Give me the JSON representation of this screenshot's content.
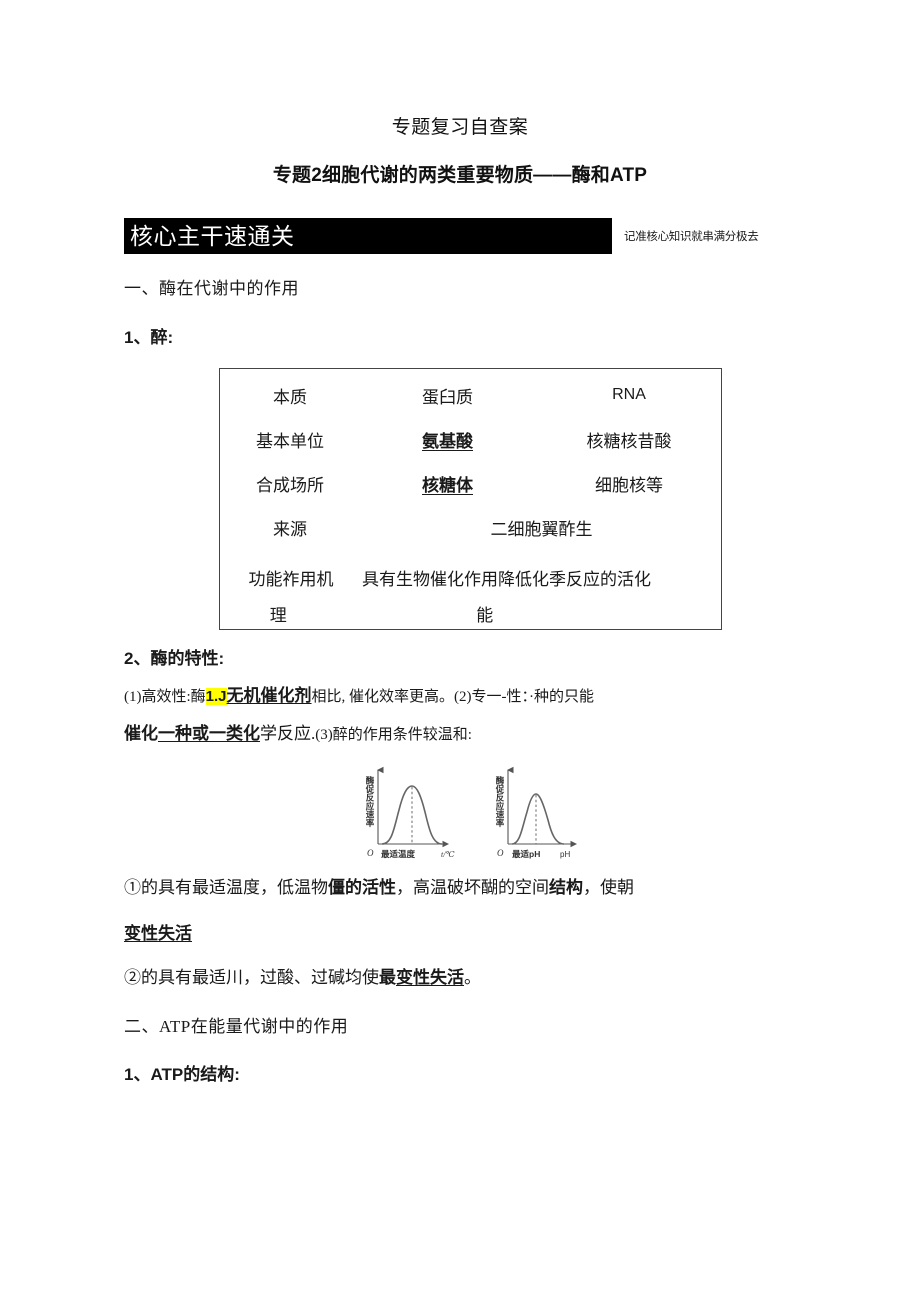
{
  "document": {
    "title": "专题复习自查案",
    "subtitle": "专题2细胞代谢的两类重要物质——酶和ATP"
  },
  "banner": {
    "label": "核心主干速通关",
    "note": "记准核心知识就串满分极去",
    "background_color": "#000000",
    "text_color": "#ffffff"
  },
  "sections": {
    "section1_heading": "一、酶在代谢中的作用",
    "item1_label": "1、醉:",
    "item2_label": "2、酶的特性:",
    "section2_heading": "二、ATP在能量代谢中的作用",
    "item_atp_label": "1、ATP的结构:"
  },
  "enzyme_table": {
    "rows": [
      {
        "label": "本质",
        "col2": "蛋臼质",
        "col3": "RNA"
      },
      {
        "label": "基本单位",
        "col2": "氨基酸",
        "col3": "核糖核昔酸"
      },
      {
        "label": "合成场所",
        "col2": "核糖体",
        "col3": "细胞核等"
      },
      {
        "label": "来源",
        "merged": "二细胞翼酢生"
      }
    ],
    "function_row": {
      "label_line1": "功能祚用机",
      "label_line2": "理",
      "body_line1": "具有生物催化作用降低化季反应的活化",
      "body_line2": "能"
    }
  },
  "feature_paragraph": {
    "line1_part1": "(1)高效性:酶",
    "line1_highlight": "1.J",
    "line1_underline": "无机催化剂",
    "line1_part2": "相比, 催化效率更高。(2)专一-性：·种的只能",
    "line2_part1": "催化",
    "line2_underline": "一种或一类化",
    "line2_part2": "学反应.",
    "line2_part3": "(3)醉的作用条件较温和:"
  },
  "post_chart_text": {
    "line1_part1": "①的具有最适温度，低温物",
    "line1_bold1": "僵的活性",
    "line1_part2": "，高温破坏醐的空间",
    "line1_bold2": "结构",
    "line1_part3": "，使朝",
    "line1_cont_underline": "变性失活",
    "line2_part1": "②的具有最适川，过酸、过碱均使",
    "line2_bold": "最",
    "line2_underline": "变性失活",
    "line2_part2": "。"
  },
  "chart_data": [
    {
      "type": "line",
      "title": "",
      "ylabel": "酶促反应速率",
      "xlabel": "",
      "origin_label": "O",
      "x_tick_labels": [
        "最适温度"
      ],
      "x_axis_unit": "t/℃",
      "annotation": "bell curve peaking at optimum temperature",
      "x": [
        0,
        0.1,
        0.2,
        0.3,
        0.4,
        0.5,
        0.6,
        0.7,
        0.8,
        0.9,
        1.0
      ],
      "values": [
        0,
        2,
        8,
        24,
        55,
        88,
        100,
        82,
        45,
        14,
        2
      ],
      "peak_x": 0.55,
      "grid": false,
      "legend": "none"
    },
    {
      "type": "line",
      "title": "",
      "ylabel": "酶促反应速率",
      "xlabel": "",
      "origin_label": "O",
      "x_tick_labels": [
        "最适pH"
      ],
      "x_axis_unit": "pH",
      "annotation": "bell curve peaking at optimum pH",
      "x": [
        0,
        0.1,
        0.2,
        0.3,
        0.4,
        0.5,
        0.6,
        0.7,
        0.8,
        0.9,
        1.0
      ],
      "values": [
        0,
        3,
        14,
        48,
        86,
        100,
        90,
        62,
        30,
        9,
        1
      ],
      "peak_x": 0.48,
      "grid": false,
      "legend": "none"
    }
  ]
}
